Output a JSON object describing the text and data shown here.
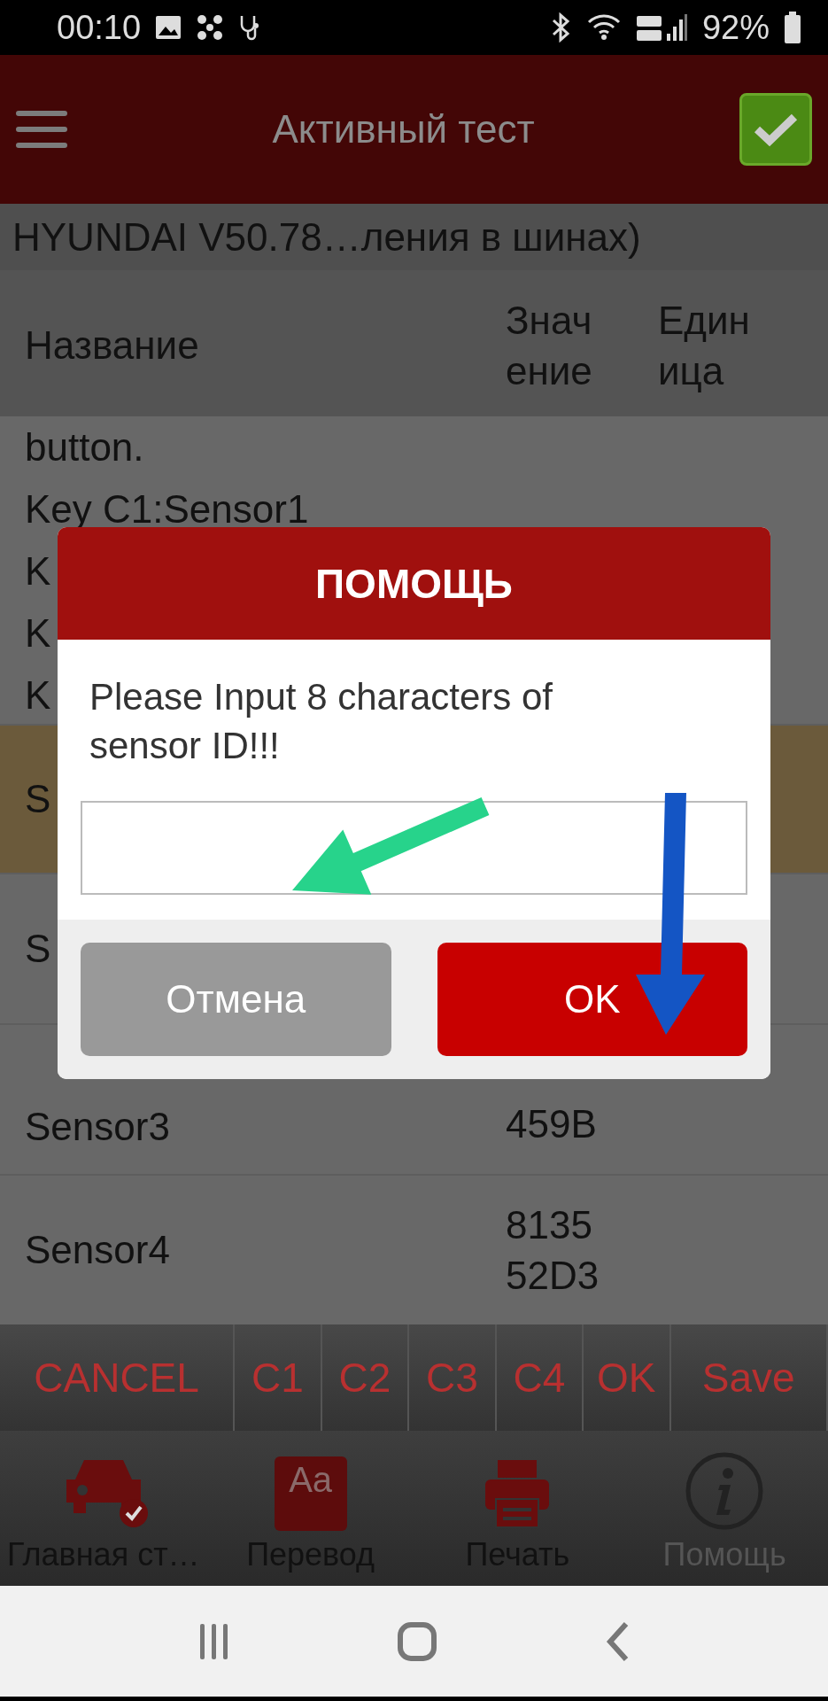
{
  "status_bar": {
    "time": "00:10",
    "battery": "92%"
  },
  "header": {
    "title": "Активный тест",
    "confirmed": true
  },
  "subtitle": "HYUNDAI V50.78…ления в шинах)",
  "table": {
    "columns": [
      "Название",
      "Значение",
      "Единица"
    ],
    "help_lines": [
      "button.",
      "Key C1:Sensor1",
      "K",
      "K",
      "K"
    ],
    "rows": [
      {
        "name": "S",
        "selected": true
      },
      {
        "name": "S",
        "selected": false
      },
      {
        "name": "Sensor3",
        "value": "459B",
        "selected": false
      },
      {
        "name": "Sensor4",
        "value": "813552D3",
        "selected": false
      }
    ]
  },
  "keys": [
    "CANCEL",
    "C1",
    "C2",
    "C3",
    "C4",
    "OK",
    "Save"
  ],
  "nav": [
    {
      "kind": "car",
      "label": "Главная ст…",
      "disabled": false
    },
    {
      "kind": "book",
      "label": "Перевод",
      "icon_text": "Aa",
      "disabled": false
    },
    {
      "kind": "printer",
      "label": "Печать",
      "disabled": false
    },
    {
      "kind": "info",
      "label": "Помощь",
      "disabled": true
    }
  ],
  "dialog": {
    "title": "ПОМОЩЬ",
    "message": "Please Input 8 characters of sensor ID!!!",
    "buttons": [
      {
        "label": "Отмена",
        "kind": "secondary"
      },
      {
        "label": "OK",
        "kind": "primary"
      }
    ]
  }
}
